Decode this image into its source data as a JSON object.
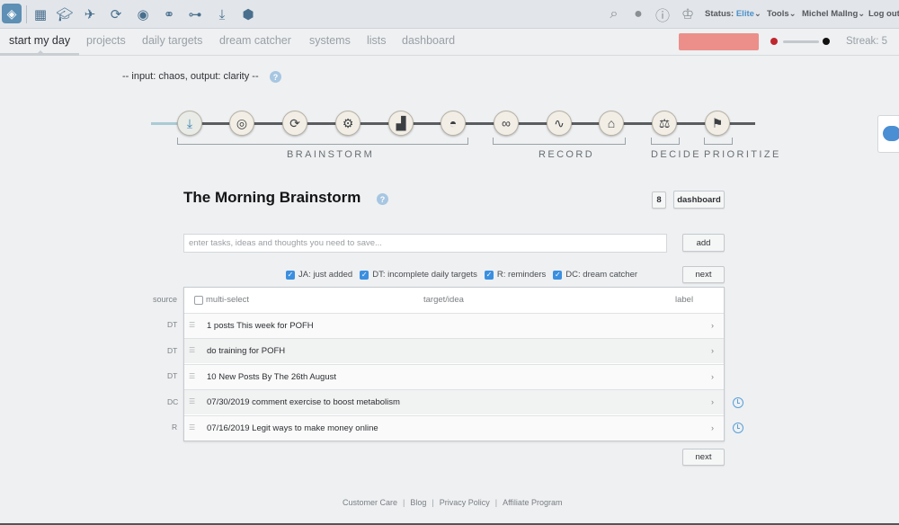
{
  "toolbar": {
    "icons": [
      "dashboard-icon",
      "graduation-cap-icon",
      "airplane-icon",
      "sync-icon",
      "eye-icon",
      "glasses-icon",
      "hierarchy-icon",
      "download-icon",
      "cube-icon"
    ],
    "right_icons": [
      "search-icon",
      "lightbulb-icon",
      "help-icon",
      "chess-king-icon"
    ],
    "status_label": "Status:",
    "status_value": "Elite",
    "tools_label": "Tools",
    "user_label": "Michel Mallng",
    "logout_label": "Log out"
  },
  "nav": {
    "tabs": [
      "start my day",
      "projects",
      "daily targets",
      "dream catcher",
      "systems",
      "lists",
      "dashboard"
    ],
    "streak": "Streak: 5"
  },
  "tagline": "-- input: chaos, output: clarity --",
  "workflow": {
    "labels": [
      "BRAINSTORM",
      "RECORD",
      "DECIDE",
      "PRIORITIZE"
    ],
    "steps": [
      "inbox-download-icon",
      "target-icon",
      "refresh-icon",
      "gears-icon",
      "chart-icon",
      "piggy-bank-icon",
      "link-icon",
      "pulse-icon",
      "bank-icon",
      "scale-icon",
      "flag-icon"
    ]
  },
  "heading": {
    "title": "The Morning Brainstorm",
    "count": "8",
    "dashboard_button": "dashboard"
  },
  "input": {
    "placeholder": "enter tasks, ideas and thoughts you need to save...",
    "add_button": "add"
  },
  "filters": [
    {
      "label": "JA: just added",
      "checked": true
    },
    {
      "label": "DT: incomplete daily targets",
      "checked": true
    },
    {
      "label": "R: reminders",
      "checked": true
    },
    {
      "label": "DC: dream catcher",
      "checked": true
    }
  ],
  "next_button": "next",
  "table": {
    "source_header": "source",
    "multi_select_header": "multi-select",
    "target_header": "target/idea",
    "label_header": "label",
    "rows": [
      {
        "source": "DT",
        "text": "1 posts This week for POFH"
      },
      {
        "source": "DT",
        "text": "do training for POFH"
      },
      {
        "source": "DT",
        "text": "10 New Posts By The 26th August"
      },
      {
        "source": "DC",
        "text": "07/30/2019 comment exercise to boost metabolism"
      },
      {
        "source": "R",
        "text": "07/16/2019 Legit ways to make money online"
      }
    ]
  },
  "footer": {
    "links": [
      "Customer Care",
      "Blog",
      "Privacy Policy",
      "Affiliate Program"
    ]
  }
}
